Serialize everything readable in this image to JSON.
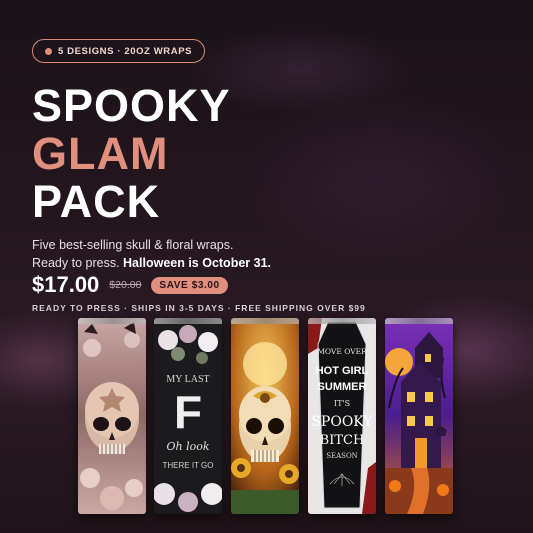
{
  "badge": {
    "text": "5 DESIGNS · 20OZ WRAPS",
    "dot_color": "#e08f7c"
  },
  "title": {
    "line1": "SPOOKY",
    "line2": "GLAM",
    "line3": "PACK",
    "accent_color": "#e0907d"
  },
  "description": {
    "line1": "Five best-selling skull & floral wraps.",
    "line2_prefix": "Ready to press.",
    "line2_bold": "Halloween is October 31."
  },
  "pricing": {
    "price": "$17.00",
    "old_price": "$20.00",
    "save_label": "SAVE $3.00"
  },
  "shipping_line": "READY TO PRESS  ·  SHIPS IN 3-5 DAYS  ·  FREE SHIPPING OVER $99",
  "tumblers": {
    "t2_text": {
      "line1": "MY LAST",
      "line2": "F",
      "line3": "Oh look",
      "line4": "THERE IT GO"
    },
    "t4_text": {
      "line1": "MOVE OVER",
      "line2": "HOT GIRL",
      "line3": "SUMMER",
      "line4": "IT'S",
      "line5": "SPOOKY",
      "line6": "BITCH",
      "line7": "SEASON"
    }
  }
}
